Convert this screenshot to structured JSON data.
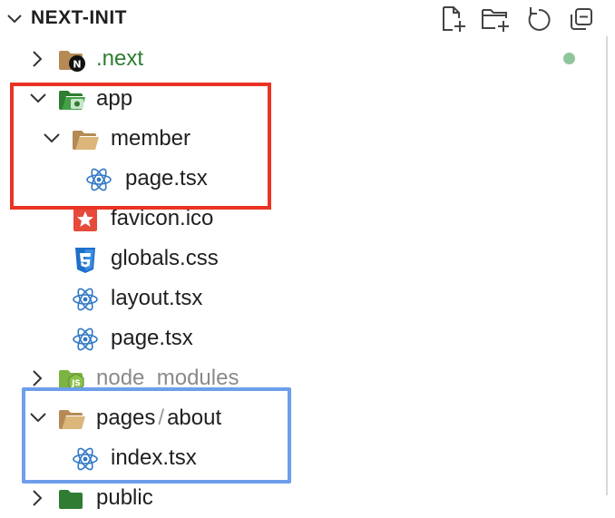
{
  "explorer": {
    "title": "NEXT-INIT",
    "actions": [
      {
        "name": "new-file-icon",
        "label": "New File"
      },
      {
        "name": "new-folder-icon",
        "label": "New Folder"
      },
      {
        "name": "refresh-icon",
        "label": "Refresh Explorer"
      },
      {
        "name": "collapse-all-icon",
        "label": "Collapse Folders"
      }
    ]
  },
  "tree": [
    {
      "label": ".next",
      "type": "folder",
      "expanded": false,
      "icon": "next-folder-icon",
      "color": "#2e7d32",
      "status": "modified-dot"
    },
    {
      "label": "app",
      "type": "folder",
      "expanded": true,
      "icon": "app-folder-icon"
    },
    {
      "label": "member",
      "type": "folder",
      "expanded": true,
      "icon": "folder-open-icon"
    },
    {
      "label": "page.tsx",
      "type": "file",
      "icon": "react-icon"
    },
    {
      "label": "favicon.ico",
      "type": "file",
      "icon": "favicon-icon"
    },
    {
      "label": "globals.css",
      "type": "file",
      "icon": "css3-icon"
    },
    {
      "label": "layout.tsx",
      "type": "file",
      "icon": "react-icon"
    },
    {
      "label": "page.tsx",
      "type": "file",
      "icon": "react-icon"
    },
    {
      "label": "node_modules",
      "type": "folder",
      "expanded": false,
      "icon": "node-folder-icon",
      "color": "#8a8a8a"
    },
    {
      "label": "pages",
      "separator": "/",
      "label2": "about",
      "type": "folder",
      "expanded": true,
      "icon": "folder-open-icon"
    },
    {
      "label": "index.tsx",
      "type": "file",
      "icon": "react-icon"
    },
    {
      "label": "public",
      "type": "folder",
      "expanded": false,
      "icon": "public-folder-icon"
    }
  ],
  "highlights": [
    {
      "name": "red-highlight",
      "color": "#ea3323"
    },
    {
      "name": "blue-highlight",
      "color": "#6d9eeb"
    }
  ]
}
